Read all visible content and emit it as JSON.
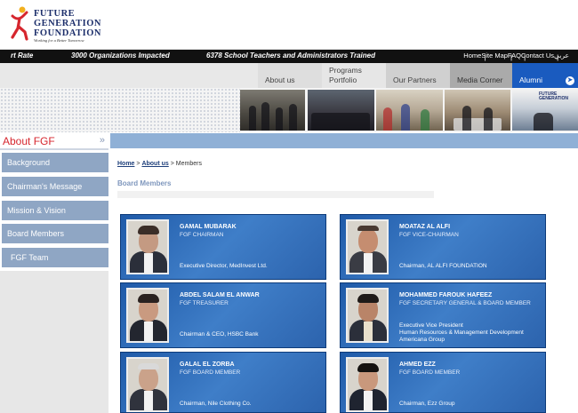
{
  "header": {
    "logo_lines": [
      "FUTURE",
      "GENERATION",
      "FOUNDATION"
    ],
    "tagline": "Working for a Better Tomorrow"
  },
  "ticker": {
    "items": [
      "rt Rate",
      "3000 Organizations Impacted",
      "6378 School Teachers  and  Administrators Trained"
    ]
  },
  "toplinks": [
    "Home",
    "Site Map",
    "FAQ",
    "Contact Us",
    "عربي"
  ],
  "nav": {
    "tabs": [
      "About us",
      "Programs Portfolio",
      "Our Partners",
      "Media Corner",
      "Alumni"
    ]
  },
  "sidebar": {
    "title": "About FGF",
    "items": [
      "Background",
      "Chairman's Message",
      "Mission & Vision",
      "Board Members",
      "FGF Team"
    ]
  },
  "breadcrumb": {
    "home": "Home",
    "about": "About us",
    "current": "Members",
    "sep": ">"
  },
  "section_title": "Board Members",
  "members": [
    {
      "name": "GAMAL MUBARAK",
      "role": "FGF CHAIRMAN",
      "desc": [
        "Executive Director, MedInvest Ltd."
      ]
    },
    {
      "name": "MOATAZ AL ALFI",
      "role": "FGF VICE-CHAIRMAN",
      "desc": [
        "Chairman, AL ALFI FOUNDATION"
      ]
    },
    {
      "name": "ABDEL SALAM EL ANWAR",
      "role": "FGF TREASURER",
      "desc": [
        "Chairman & CEO, HSBC Bank"
      ]
    },
    {
      "name": "MOHAMMED FAROUK HAFEEZ",
      "role": "FGF SECRETARY GENERAL & BOARD MEMBER",
      "desc": [
        "Executive Vice President",
        "Human Resources & Management Development",
        "Americana Group"
      ]
    },
    {
      "name": "GALAL EL ZORBA",
      "role": "FGF BOARD MEMBER",
      "desc": [
        "Chairman, Nile Clothing Co."
      ]
    },
    {
      "name": "AHMED EZZ",
      "role": "FGF BOARD MEMBER",
      "desc": [
        "Chairman, Ezz Group"
      ]
    }
  ],
  "colors": {
    "brand_red": "#d6262e",
    "brand_navy": "#1d2f6b",
    "card_blue": "#2c63ad",
    "sidebar_blue": "#8fa6c4",
    "alumni_blue": "#1a5bbf"
  }
}
